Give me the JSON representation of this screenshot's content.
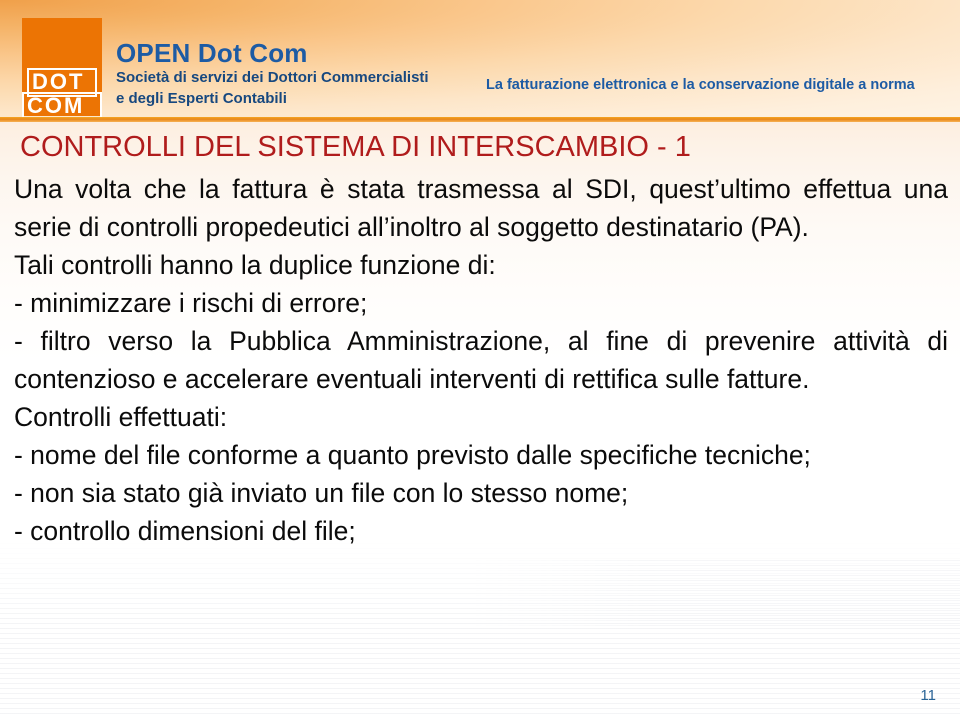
{
  "header": {
    "logo": {
      "line1": "DOT",
      "line2": "COM"
    },
    "brand_title": "OPEN Dot Com",
    "brand_line1": "Società di servizi dei Dottori Commercialisti",
    "brand_line2": "e degli Esperti Contabili",
    "subject": "La fatturazione elettronica e la conservazione digitale a norma",
    "colors": {
      "brand_blue": "#1d5ba4",
      "logo_orange": "#ec7404",
      "rule_orange": "#e8871a"
    }
  },
  "slide": {
    "title": "CONTROLLI DEL SISTEMA DI INTERSCAMBIO - 1",
    "title_color": "#b01c1c",
    "paragraphs": [
      "Una volta che la fattura è stata trasmessa al SDI, quest’ultimo effettua una serie di controlli propedeutici all’inoltro al soggetto destinatario (PA).",
      "Tali controlli hanno la duplice funzione di:",
      "- minimizzare i rischi di errore;",
      "- filtro verso la Pubblica Amministrazione, al fine di prevenire attività di contenzioso e accelerare eventuali interventi di rettifica sulle fatture.",
      "Controlli effettuati:",
      "- nome del file conforme a quanto previsto dalle specifiche tecniche;",
      "- non sia stato già inviato un file con lo stesso nome;",
      "- controllo dimensioni del file;"
    ],
    "page_number": "11"
  }
}
